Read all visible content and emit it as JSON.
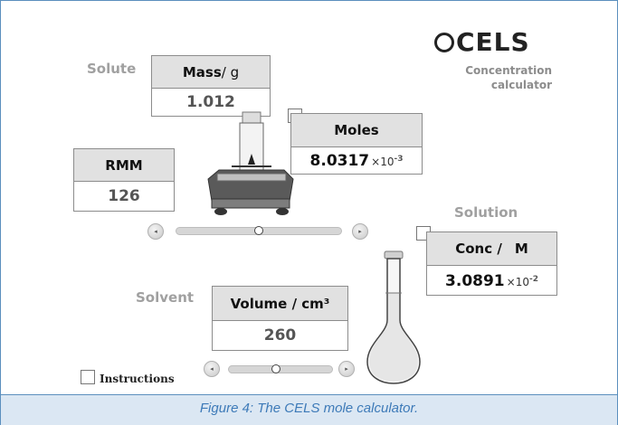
{
  "labels": {
    "solute": "Solute",
    "solution": "Solution",
    "solvent": "Solvent"
  },
  "logo": {
    "name": "CELS",
    "line1": "Concentration",
    "line2": "calculator"
  },
  "mass": {
    "header_bold": "Mass",
    "header_unit": " / g",
    "value": "1.012"
  },
  "moles": {
    "header": "Moles",
    "mantissa": "8.0317",
    "times": "×10",
    "exponent": "-3"
  },
  "rmm": {
    "header": "RMM",
    "value": "126"
  },
  "conc": {
    "header_text": "Conc /",
    "header_unit": "M",
    "mantissa": "3.0891",
    "times": "×10",
    "exponent": "-2"
  },
  "volume": {
    "header": "Volume / cm³",
    "value": "260"
  },
  "instructions": {
    "label": "Instructions"
  },
  "sliders": {
    "mass_slider_level": 0.5,
    "volume_slider_level": 0.46,
    "prev_glyph": "◂",
    "next_glyph": "▸"
  },
  "caption": "Figure 4: The CELS mole calculator."
}
